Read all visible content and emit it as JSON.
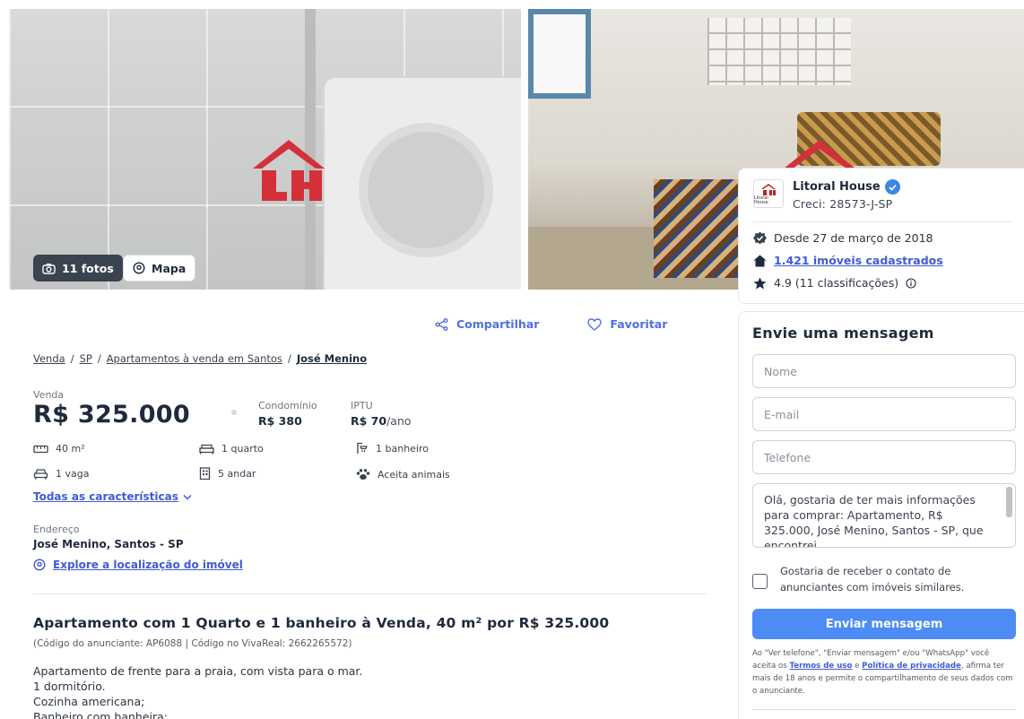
{
  "gallery": {
    "photos_button": "11 fotos",
    "map_button": "Mapa"
  },
  "actions": {
    "share": "Compartilhar",
    "favorite": "Favoritar"
  },
  "breadcrumb": {
    "items": [
      "Venda",
      "SP",
      "Apartamentos à venda em Santos"
    ],
    "current": "José Menino",
    "separator": "/"
  },
  "price": {
    "label": "Venda",
    "value": "R$ 325.000",
    "condo_label": "Condomínio",
    "condo_value": "R$ 380",
    "iptu_label": "IPTU",
    "iptu_value": "R$ 70",
    "iptu_unit": "/ano"
  },
  "features": {
    "area": "40 m²",
    "bedrooms": "1 quarto",
    "bathrooms": "1 banheiro",
    "parking": "1 vaga",
    "floor": "5 andar",
    "pets": "Aceita animais"
  },
  "all_features_link": "Todas as características",
  "address": {
    "label": "Endereço",
    "value": "José Menino, Santos - SP",
    "explore_link": "Explore a localização do imóvel"
  },
  "listing": {
    "title": "Apartamento com 1 Quarto e 1 banheiro à Venda, 40 m² por R$ 325.000",
    "codes": "(Código do anunciante: AP6088 | Código no VivaReal: 2662265572)",
    "description_lines": [
      "Apartamento de frente para a praia, com vista para o mar.",
      "1 dormitório.",
      "Cozinha americana;",
      "Banheiro com banheira;"
    ]
  },
  "advertiser": {
    "logo_text": "Litoral House",
    "name": "Litoral House",
    "creci": "Creci: 28573-J-SP",
    "since": "Desde 27 de março de 2018",
    "listings_link": "1.421 imóveis cadastrados",
    "rating": "4.9 (11 classificações)"
  },
  "form": {
    "title": "Envie uma mensagem",
    "name_placeholder": "Nome",
    "email_placeholder": "E-mail",
    "phone_placeholder": "Telefone",
    "message": "Olá, gostaria de ter mais informações para comprar: Apartamento, R$ 325.000, José Menino, Santos - SP, que encontrei",
    "checkbox_label": "Gostaria de receber o contato de anunciantes com imóveis similares.",
    "submit": "Enviar mensagem",
    "legal_prefix": "Ao \"Ver telefone\", \"Enviar mensagem\" e/ou \"WhatsApp\" você aceita os",
    "terms_link": "Termos de uso",
    "legal_and": "e",
    "privacy_link": "Política de privacidade",
    "legal_suffix": ", afirma ter mais de 18 anos e permite o compartilhamento de seus dados com o anunciante."
  },
  "colors": {
    "accent": "#4d8cf5",
    "link": "#3f5bd6",
    "brand_red": "#d4303a"
  }
}
